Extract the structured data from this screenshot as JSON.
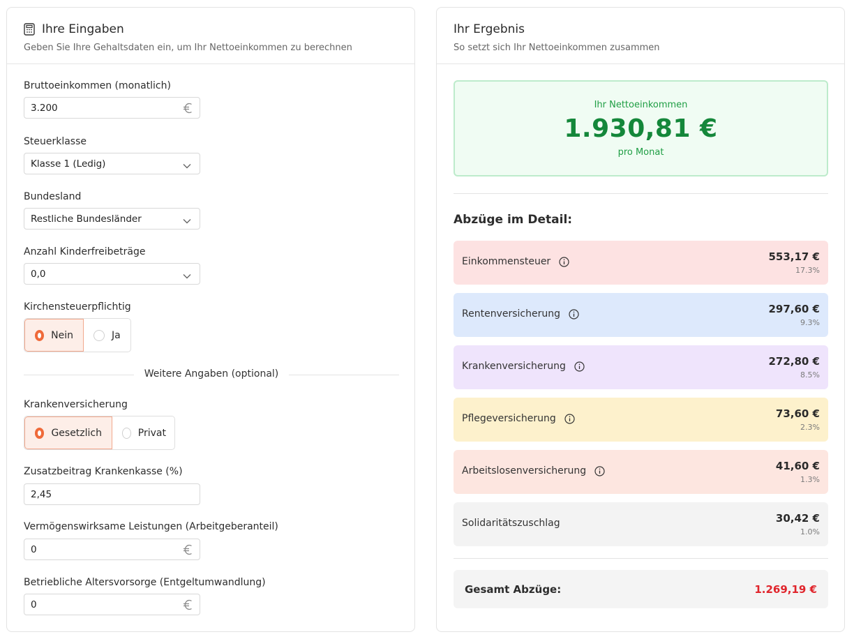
{
  "inputs": {
    "title": "Ihre Eingaben",
    "subtitle": "Geben Sie Ihre Gehaltsdaten ein, um Ihr Nettoeinkommen zu berechnen",
    "brutto": {
      "label": "Bruttoeinkommen (monatlich)",
      "value": "3.200",
      "currency": "€"
    },
    "steuerklasse": {
      "label": "Steuerklasse",
      "value": "Klasse 1 (Ledig)"
    },
    "bundesland": {
      "label": "Bundesland",
      "value": "Restliche Bundesländer"
    },
    "kinder": {
      "label": "Anzahl Kinderfreibeträge",
      "value": "0,0"
    },
    "kirchensteuer": {
      "label": "Kirchensteuerpflichtig",
      "options": [
        "Nein",
        "Ja"
      ],
      "selected": "Nein"
    },
    "divider_text": "Weitere Angaben (optional)",
    "krankenversicherung": {
      "label": "Krankenversicherung",
      "options": [
        "Gesetzlich",
        "Privat"
      ],
      "selected": "Gesetzlich"
    },
    "zusatzbeitrag": {
      "label": "Zusatzbeitrag Krankenkasse (%)",
      "value": "2,45"
    },
    "vwl": {
      "label": "Vermögenswirksame Leistungen (Arbeitgeberanteil)",
      "value": "0",
      "currency": "€"
    },
    "bav": {
      "label": "Betriebliche Altersvorsorge (Entgeltumwandlung)",
      "value": "0",
      "currency": "€"
    }
  },
  "result": {
    "title": "Ihr Ergebnis",
    "subtitle": "So setzt sich Ihr Nettoeinkommen zusammen",
    "net_label": "Ihr Nettoeinkommen",
    "net_value": "1.930,81 €",
    "net_period": "pro Monat",
    "detail_title": "Abzüge im Detail:",
    "deductions": [
      {
        "name": "Einkommensteuer",
        "amount": "553,17 €",
        "percent": "17.3%",
        "color": "#fde2e2",
        "info": true
      },
      {
        "name": "Rentenversicherung",
        "amount": "297,60 €",
        "percent": "9.3%",
        "color": "#dde9fc",
        "info": true
      },
      {
        "name": "Krankenversicherung",
        "amount": "272,80 €",
        "percent": "8.5%",
        "color": "#efe4fc",
        "info": true
      },
      {
        "name": "Pflegeversicherung",
        "amount": "73,60 €",
        "percent": "2.3%",
        "color": "#fdf1cc",
        "info": true
      },
      {
        "name": "Arbeitslosenversicherung",
        "amount": "41,60 €",
        "percent": "1.3%",
        "color": "#fde6e0",
        "info": true
      },
      {
        "name": "Solidaritätszuschlag",
        "amount": "30,42 €",
        "percent": "1.0%",
        "color": "#f3f3f3",
        "info": false
      }
    ],
    "total_label": "Gesamt Abzüge:",
    "total_value": "1.269,19 €"
  }
}
